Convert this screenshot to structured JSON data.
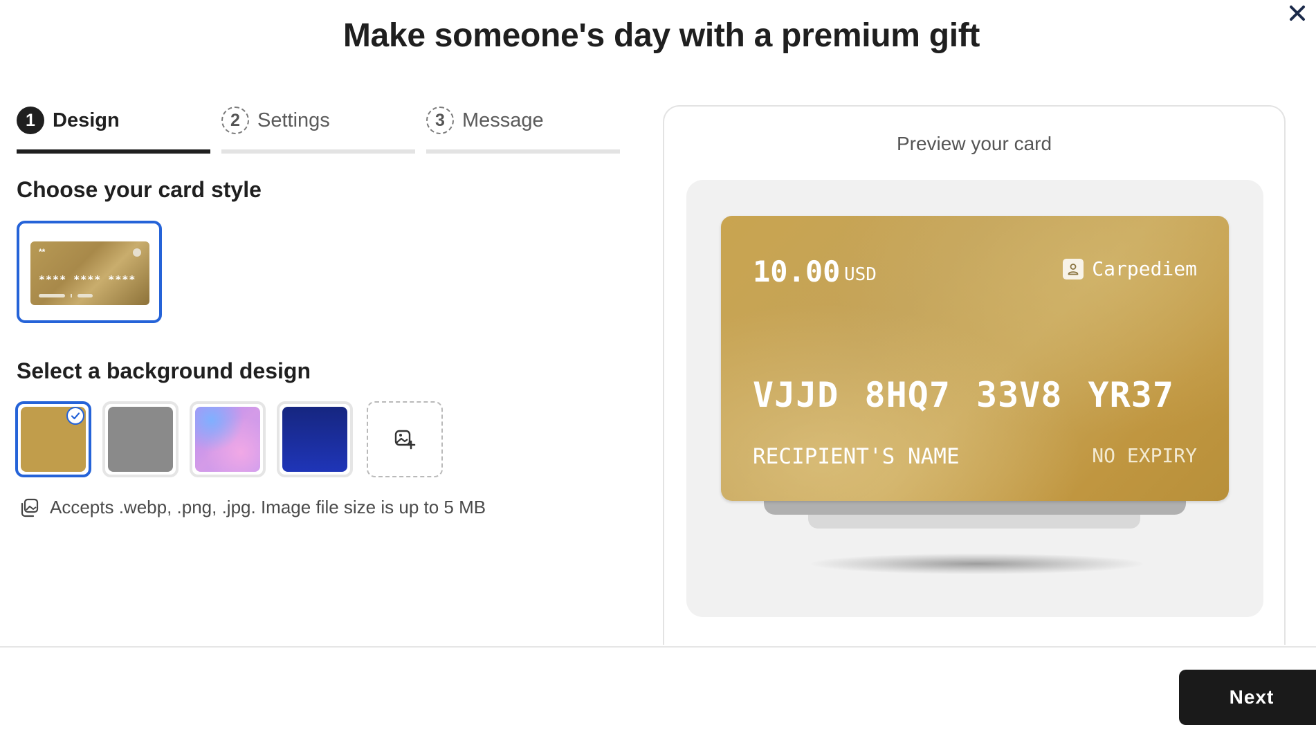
{
  "dialog": {
    "title": "Make someone's day with a premium gift",
    "close_icon": "close-icon"
  },
  "steps": [
    {
      "number": "1",
      "label": "Design",
      "active": true
    },
    {
      "number": "2",
      "label": "Settings",
      "active": false
    },
    {
      "number": "3",
      "label": "Message",
      "active": false
    }
  ],
  "card_style": {
    "heading": "Choose your card style",
    "option": {
      "top_stars": "**",
      "stars": "**** **** ****",
      "selected": true
    }
  },
  "background": {
    "heading": "Select a background design",
    "swatches": [
      {
        "name": "gold",
        "color": "#c19d4b",
        "selected": true
      },
      {
        "name": "gray",
        "color": "#8a8a8a",
        "selected": false
      },
      {
        "name": "aurora",
        "color": "#c08fe8",
        "selected": false
      },
      {
        "name": "navy",
        "color": "#1f2fa8",
        "selected": false
      }
    ],
    "upload_icon": "image-plus-icon",
    "hint": "Accepts .webp, .png, .jpg. Image file size is up to 5 MB"
  },
  "preview": {
    "title": "Preview your card",
    "card": {
      "amount": "10.00",
      "currency": "USD",
      "brand": "Carpediem",
      "code": "VJJD 8HQ7 33V8 YR37",
      "recipient": "RECIPIENT'S NAME",
      "expiry": "NO EXPIRY"
    }
  },
  "footer": {
    "next_label": "Next"
  },
  "colors": {
    "accent": "#2563d8",
    "dark": "#1a1a1a",
    "gold": "#c4a359"
  }
}
